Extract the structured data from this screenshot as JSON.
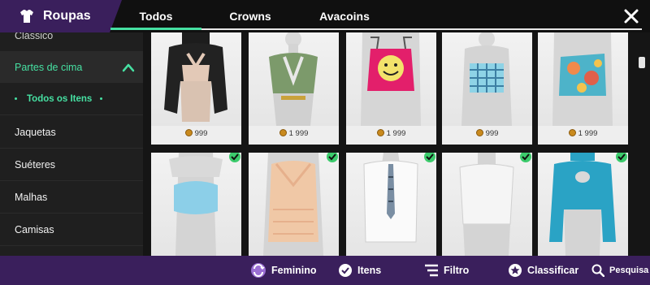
{
  "header": {
    "brand_icon": "shirt-icon",
    "brand_title": "Roupas",
    "tabs": [
      {
        "label": "Todos",
        "active": true
      },
      {
        "label": "Crowns"
      },
      {
        "label": "Avacoins"
      }
    ],
    "close_icon": "close-icon"
  },
  "sidebar": {
    "items": [
      {
        "label": "Clássico",
        "partial": true
      },
      {
        "label": "Partes de cima",
        "active": true,
        "icon": "chevron-up-icon"
      },
      {
        "label": "Todos os Itens",
        "sub": true
      },
      {
        "label": "Jaquetas"
      },
      {
        "label": "Suéteres"
      },
      {
        "label": "Malhas"
      },
      {
        "label": "Camisas"
      }
    ]
  },
  "grid": {
    "rows": [
      [
        {
          "item": "black-cutout-top",
          "price": "999",
          "currency_icon": "coin-icon"
        },
        {
          "item": "green-crop-shirt",
          "price": "1 999",
          "currency_icon": "coin-icon"
        },
        {
          "item": "pink-smiley-tank",
          "price": "1 999",
          "currency_icon": "coin-icon"
        },
        {
          "item": "plaid-tube-top",
          "price": "999",
          "currency_icon": "coin-icon"
        },
        {
          "item": "tie-dye-bandeau",
          "price": "1 999",
          "currency_icon": "coin-icon"
        }
      ],
      [
        {
          "item": "blue-tube-top",
          "owned": true
        },
        {
          "item": "peach-lace-top",
          "owned": true
        },
        {
          "item": "white-shirt-tie",
          "owned": true
        },
        {
          "item": "white-longsleeve",
          "owned": true
        },
        {
          "item": "teal-cutout-top",
          "owned": true
        }
      ]
    ]
  },
  "bottom_bar": {
    "items": [
      {
        "label": "Feminino",
        "icon": "gender-swap-icon"
      },
      {
        "label": "Itens",
        "icon": "check-circle-icon"
      },
      {
        "label": "Filtro",
        "icon": "filter-icon"
      },
      {
        "label": "Classificar",
        "icon": "star-badge-icon"
      },
      {
        "label": "Pesquisa",
        "icon": "search-icon"
      }
    ]
  },
  "colors": {
    "accent": "#46e0a2",
    "purple": "#3a1f5c",
    "owned_check": "#3ccb6c"
  }
}
